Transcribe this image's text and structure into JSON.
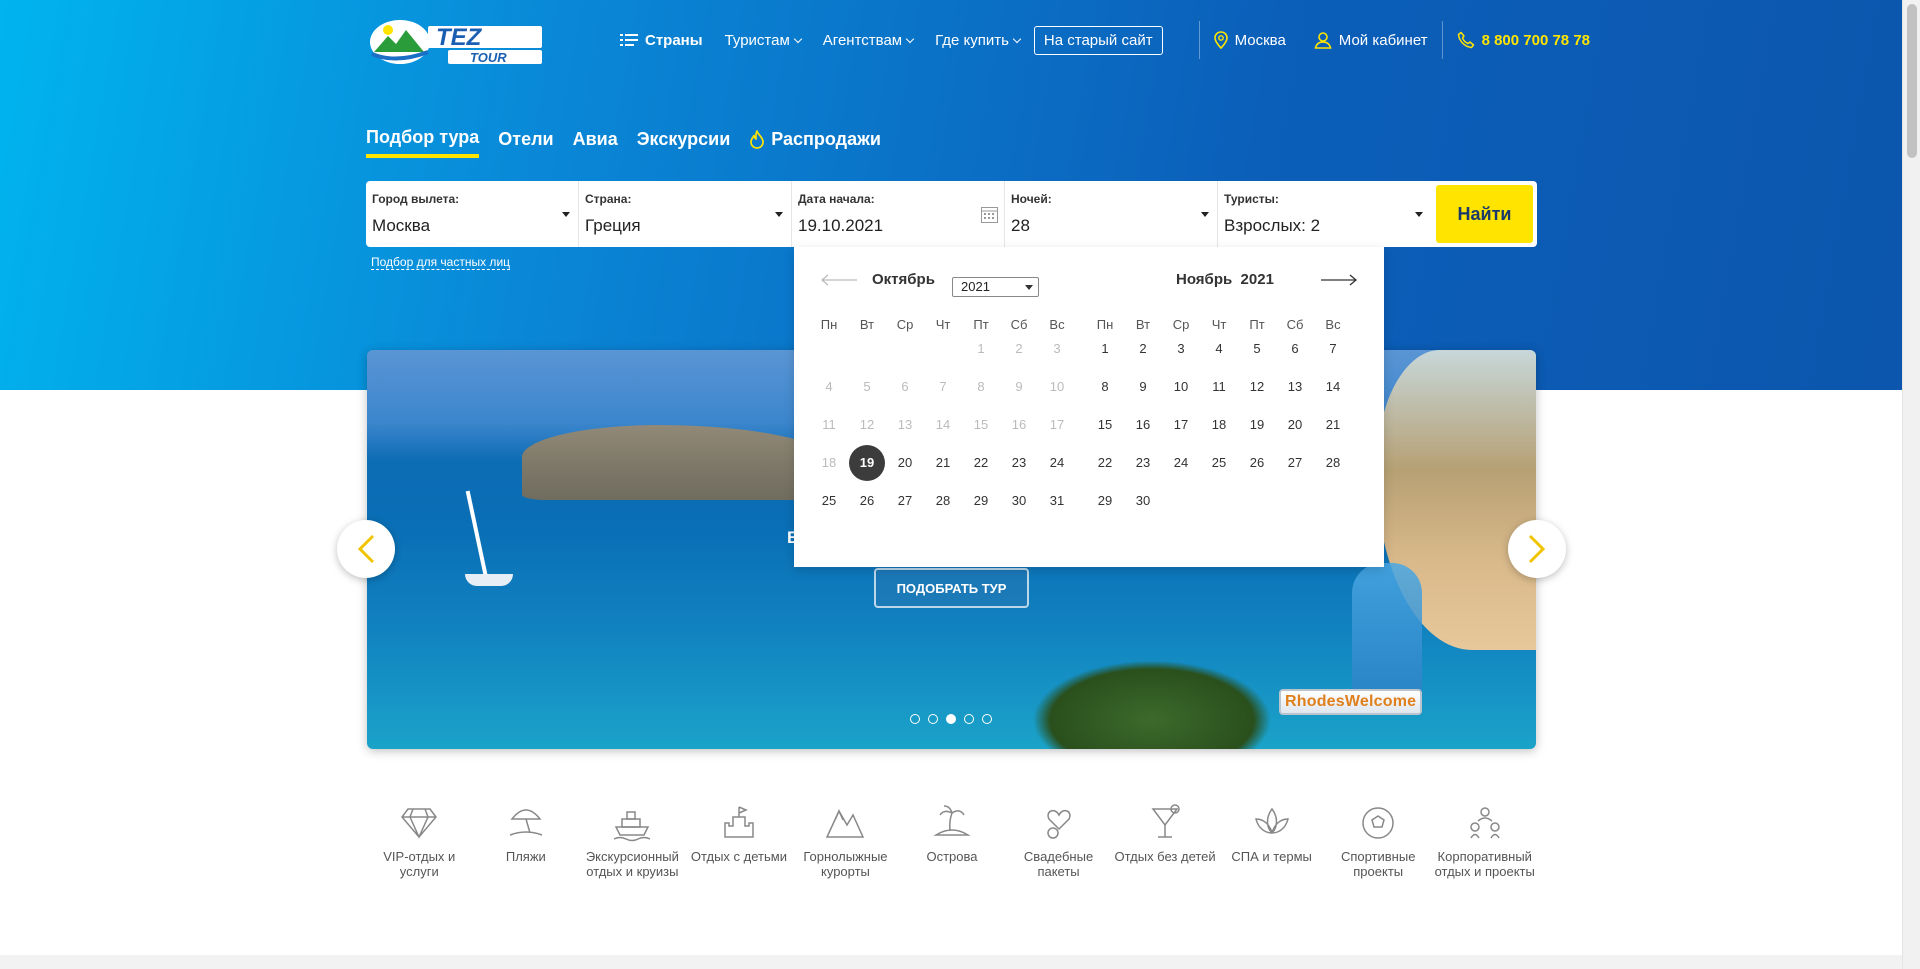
{
  "header": {
    "logo_text": "TEZ TOUR",
    "nav": {
      "countries": "Страны",
      "tourists": "Туристам",
      "agencies": "Агентствам",
      "where_to_buy": "Где купить",
      "old_site": "На старый сайт",
      "city": "Москва",
      "cabinet": "Мой кабинет",
      "phone": "8 800 700 78 78"
    }
  },
  "tabs": [
    "Подбор тура",
    "Отели",
    "Авиа",
    "Экскурсии",
    "Распродажи"
  ],
  "search": {
    "departure": {
      "label": "Город вылета:",
      "value": "Москва"
    },
    "country": {
      "label": "Страна:",
      "value": "Греция"
    },
    "start_date": {
      "label": "Дата начала:",
      "value": "19.10.2021"
    },
    "nights": {
      "label": "Ночей:",
      "value": "28"
    },
    "tourists": {
      "label": "Туристы:",
      "value": "Взрослых: 2"
    },
    "find_button": "Найти",
    "private_link": "Подбор для частных лиц"
  },
  "calendar": {
    "left_month": "Октябрь",
    "left_year": "2021",
    "right_month": "Ноябрь",
    "right_year": "2021",
    "weekdays": [
      "Пн",
      "Вт",
      "Ср",
      "Чт",
      "Пт",
      "Сб",
      "Вс"
    ],
    "selected_day": "19",
    "october": [
      [
        "",
        "",
        "",
        "",
        "1",
        "2",
        "3"
      ],
      [
        "4",
        "5",
        "6",
        "7",
        "8",
        "9",
        "10"
      ],
      [
        "11",
        "12",
        "13",
        "14",
        "15",
        "16",
        "17"
      ],
      [
        "18",
        "19",
        "20",
        "21",
        "22",
        "23",
        "24"
      ],
      [
        "25",
        "26",
        "27",
        "28",
        "29",
        "30",
        "31"
      ]
    ],
    "october_disabled_through": 18,
    "november": [
      [
        "1",
        "2",
        "3",
        "4",
        "5",
        "6",
        "7"
      ],
      [
        "8",
        "9",
        "10",
        "11",
        "12",
        "13",
        "14"
      ],
      [
        "15",
        "16",
        "17",
        "18",
        "19",
        "20",
        "21"
      ],
      [
        "22",
        "23",
        "24",
        "25",
        "26",
        "27",
        "28"
      ],
      [
        "29",
        "30",
        "",
        "",
        "",
        "",
        ""
      ]
    ]
  },
  "banner": {
    "button": "ПОДОБРАТЬ ТУР",
    "partial_text": "В",
    "watermark": "RhodesWelcome",
    "slides": 5,
    "active_slide": 3
  },
  "categories": [
    {
      "label": "VIP-отдых и услуги",
      "icon": "diamond-icon"
    },
    {
      "label": "Пляжи",
      "icon": "beach-umbrella-icon"
    },
    {
      "label": "Экскурсионный отдых и круизы",
      "icon": "cruise-ship-icon"
    },
    {
      "label": "Отдых с детьми",
      "icon": "sand-castle-icon"
    },
    {
      "label": "Горнолыжные курорты",
      "icon": "mountains-icon"
    },
    {
      "label": "Острова",
      "icon": "island-palm-icon"
    },
    {
      "label": "Свадебные пакеты",
      "icon": "wedding-icon"
    },
    {
      "label": "Отдых без детей",
      "icon": "cocktail-icon"
    },
    {
      "label": "СПА и термы",
      "icon": "lotus-icon"
    },
    {
      "label": "Спортивные проекты",
      "icon": "soccer-ball-icon"
    },
    {
      "label": "Корпоративный отдых и проекты",
      "icon": "team-icon"
    }
  ],
  "colors": {
    "accent_yellow": "#ffe400",
    "hero_blue": "#0b5fb9",
    "selected_day": "#3c3c3c"
  }
}
